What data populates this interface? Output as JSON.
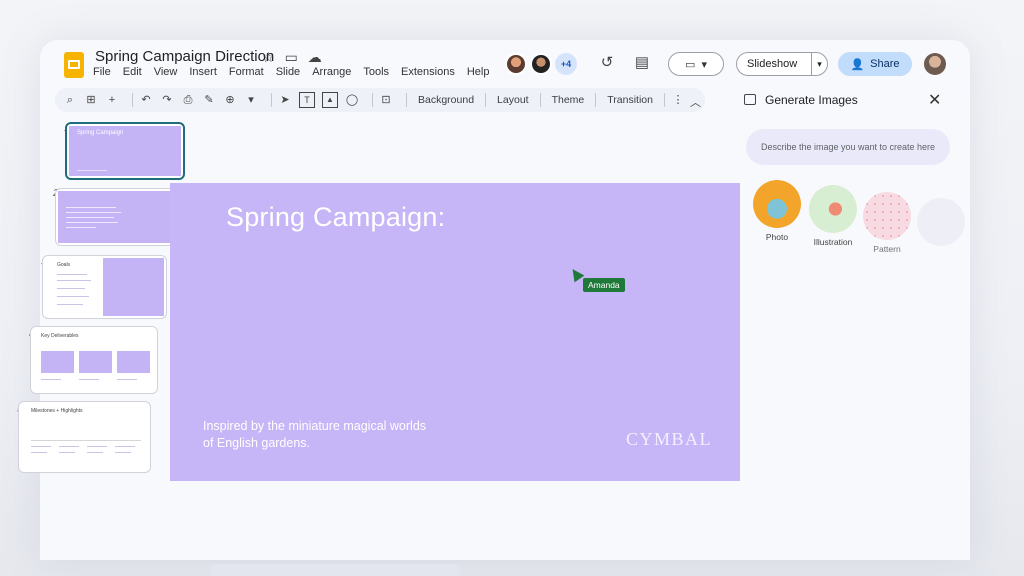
{
  "app": {
    "title": "Spring Campaign Direction",
    "menu": [
      "File",
      "Edit",
      "View",
      "Insert",
      "Format",
      "Slide",
      "Arrange",
      "Tools",
      "Extensions",
      "Help"
    ]
  },
  "header": {
    "collaborator_count": "+4",
    "slideshow_label": "Slideshow",
    "share_label": "Share"
  },
  "toolbar": {
    "background": "Background",
    "layout": "Layout",
    "theme": "Theme",
    "transition": "Transition"
  },
  "filmstrip": {
    "slides": [
      {
        "num": "1",
        "title": "Spring Campaign"
      },
      {
        "num": "2"
      },
      {
        "num": "3",
        "title": "Goals"
      },
      {
        "num": "4",
        "title": "Key Deliverables"
      },
      {
        "num": "5",
        "title": "Milestones + Highlights"
      }
    ]
  },
  "slide": {
    "title": "Spring Campaign:",
    "subtitle": "Inspired by the miniature magical worlds of English gardens.",
    "logo": "CYMBAL",
    "cursor_name": "Amanda"
  },
  "panel": {
    "title": "Generate Images",
    "prompt_placeholder": "Describe the image you want to create here",
    "styles": [
      "Photo",
      "Illustration",
      "Pattern"
    ]
  },
  "colors": {
    "slide_bg": "#c6b5f7",
    "accent_green": "#1f7a3a",
    "share_bg": "#c2dcfb",
    "logo_yellow": "#f6b400"
  }
}
